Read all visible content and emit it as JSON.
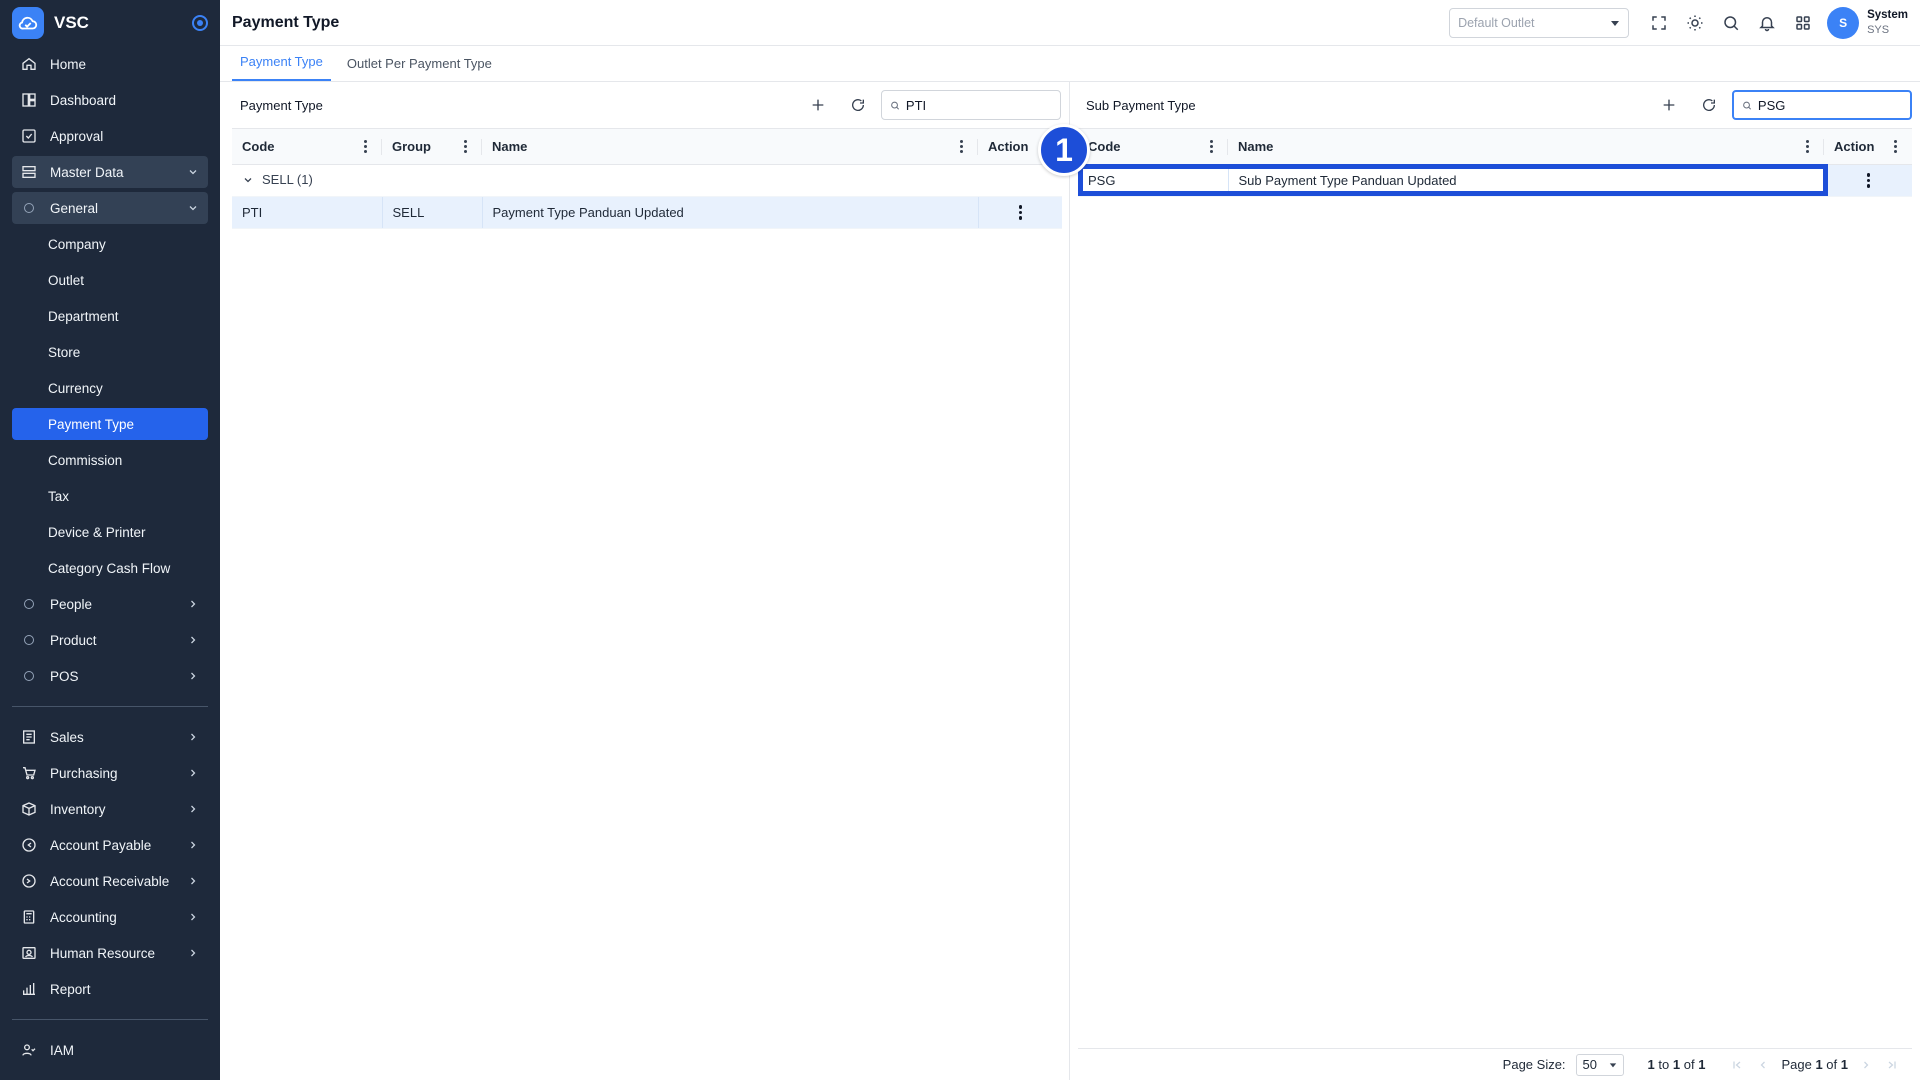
{
  "app": {
    "name": "VSC"
  },
  "sidebar": {
    "top_items": [
      {
        "label": "Home",
        "icon": "home-icon"
      },
      {
        "label": "Dashboard",
        "icon": "dashboard-icon"
      },
      {
        "label": "Approval",
        "icon": "approval-icon"
      }
    ],
    "master_data": {
      "label": "Master Data",
      "icon": "master-data-icon"
    },
    "general": {
      "label": "General"
    },
    "general_items": [
      "Company",
      "Outlet",
      "Department",
      "Store",
      "Currency",
      "Payment Type",
      "Commission",
      "Tax",
      "Device & Printer",
      "Category Cash Flow"
    ],
    "active_item": "Payment Type",
    "collapsed_groups": [
      "People",
      "Product",
      "POS"
    ],
    "modules": [
      {
        "label": "Sales",
        "icon": "sales-icon"
      },
      {
        "label": "Purchasing",
        "icon": "cart-icon"
      },
      {
        "label": "Inventory",
        "icon": "box-icon"
      },
      {
        "label": "Account Payable",
        "icon": "payable-icon"
      },
      {
        "label": "Account Receivable",
        "icon": "receivable-icon"
      },
      {
        "label": "Accounting",
        "icon": "calculator-icon"
      },
      {
        "label": "Human Resource",
        "icon": "person-card-icon"
      },
      {
        "label": "Report",
        "icon": "report-icon"
      }
    ],
    "iam": {
      "label": "IAM",
      "icon": "users-icon"
    }
  },
  "header": {
    "title": "Payment Type",
    "outlet_placeholder": "Default Outlet",
    "user": {
      "initial": "S",
      "name": "System",
      "code": "SYS"
    }
  },
  "tabs": [
    {
      "label": "Payment Type",
      "active": true
    },
    {
      "label": "Outlet Per Payment Type",
      "active": false
    }
  ],
  "left_panel": {
    "title": "Payment Type",
    "search_value": "PTI",
    "columns": [
      "Code",
      "Group",
      "Name",
      "Action"
    ],
    "group_label": "SELL (1)",
    "rows": [
      {
        "code": "PTI",
        "group": "SELL",
        "name": "Payment Type Panduan Updated"
      }
    ]
  },
  "right_panel": {
    "title": "Sub Payment Type",
    "search_value": "PSG",
    "columns": [
      "Code",
      "Name",
      "Action"
    ],
    "rows": [
      {
        "code": "PSG",
        "name": "Sub Payment Type Panduan Updated"
      }
    ],
    "step_badge": "1",
    "footer": {
      "page_size_label": "Page Size:",
      "page_size": "50",
      "range_from": "1",
      "range_to_word": "to",
      "range_to": "1",
      "range_of_word": "of",
      "range_total": "1",
      "page_word": "Page",
      "page_current": "1",
      "page_of_word": "of",
      "page_total": "1"
    }
  },
  "colors": {
    "sidebar_bg": "#1e293b",
    "accent": "#2563eb",
    "highlight": "#1d4ed8",
    "selected_row": "#e8f1fd"
  }
}
